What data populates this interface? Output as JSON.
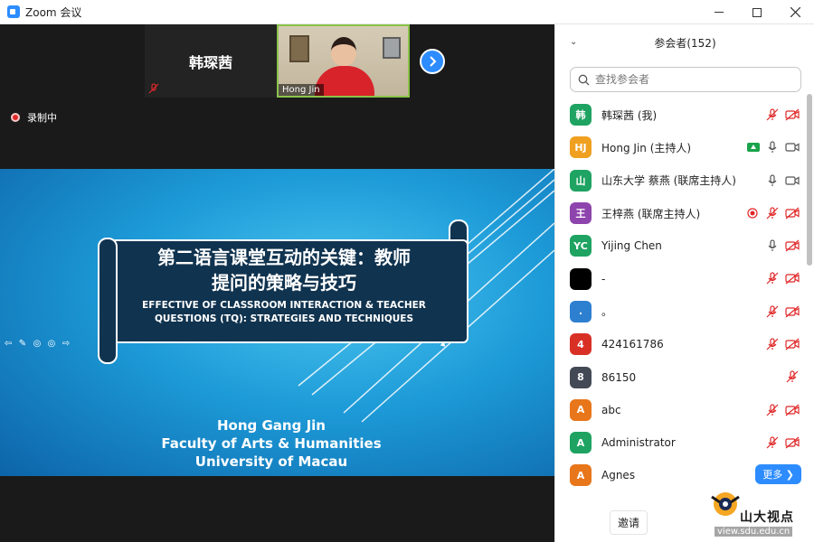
{
  "window": {
    "title": "Zoom 会议",
    "min_icon": "minimize-icon",
    "max_icon": "maximize-icon",
    "close_icon": "close-icon"
  },
  "video_strip": {
    "name_tile": "韩琛茜",
    "video_label": "Hong Jin",
    "next_icon": "chevron-right-icon",
    "recording_label": "录制中"
  },
  "slide": {
    "title_cn_line1": "第二语言课堂互动的关键：教师",
    "title_cn_line2": "提问的策略与技巧",
    "title_en_line1": "EFFECTIVE OF CLASSROOM INTERACTION & TEACHER",
    "title_en_line2": "QUESTIONS (TQ): STRATEGIES AND TECHNIQUES",
    "author_line1": "Hong Gang Jin",
    "author_line2": "Faculty of Arts & Humanities",
    "author_line3": "University of Macau"
  },
  "participants_panel": {
    "title": "参会者(152)",
    "search_placeholder": "查找参会者",
    "more_label": "更多 ❯",
    "invite_label": "邀请",
    "participants": [
      {
        "initial": "韩",
        "color": "#1ea362",
        "name": "韩琛茜 (我)",
        "icons": [
          "mic-muted-icon",
          "video-off-icon"
        ]
      },
      {
        "initial": "HJ",
        "color": "#f0a020",
        "name": "Hong Jin (主持人)",
        "icons": [
          "share-screen-icon",
          "mic-icon",
          "video-icon"
        ]
      },
      {
        "initial": "山",
        "color": "#1ea362",
        "name": "山东大学 蔡燕 (联席主持人)",
        "icons": [
          "mic-icon",
          "video-icon"
        ]
      },
      {
        "initial": "王",
        "color": "#8e44ad",
        "name": "王梓燕 (联席主持人)",
        "icons": [
          "record-icon",
          "mic-muted-icon",
          "video-off-icon"
        ]
      },
      {
        "initial": "YC",
        "color": "#1ea362",
        "name": "Yijing Chen",
        "icons": [
          "mic-icon",
          "video-off-icon"
        ]
      },
      {
        "initial": "",
        "color": "#000000",
        "name": "-",
        "icons": [
          "mic-muted-icon",
          "video-off-icon"
        ]
      },
      {
        "initial": ".",
        "color": "#2d7fd0",
        "name": "。",
        "icons": [
          "mic-muted-icon",
          "video-off-icon"
        ]
      },
      {
        "initial": "4",
        "color": "#d93025",
        "name": "424161786",
        "icons": [
          "mic-muted-icon",
          "video-off-icon"
        ]
      },
      {
        "initial": "8",
        "color": "#444a55",
        "name": "86150",
        "icons": [
          "mic-muted-icon"
        ]
      },
      {
        "initial": "A",
        "color": "#e8761a",
        "name": "abc",
        "icons": [
          "mic-muted-icon",
          "video-off-icon"
        ]
      },
      {
        "initial": "A",
        "color": "#1ea362",
        "name": "Administrator",
        "icons": [
          "mic-muted-icon",
          "video-off-icon"
        ]
      },
      {
        "initial": "A",
        "color": "#e8761a",
        "name": "Agnes",
        "icons": []
      },
      {
        "initial": "",
        "color": "#e8761a",
        "name": "",
        "icons": []
      }
    ]
  },
  "watermark": {
    "logo_text": "山大视点",
    "logo_sub": "view.sdu.edu.cn"
  },
  "colors": {
    "accent": "#2d8cff",
    "muted_red": "#e02828",
    "active_border": "#8bc34a"
  }
}
